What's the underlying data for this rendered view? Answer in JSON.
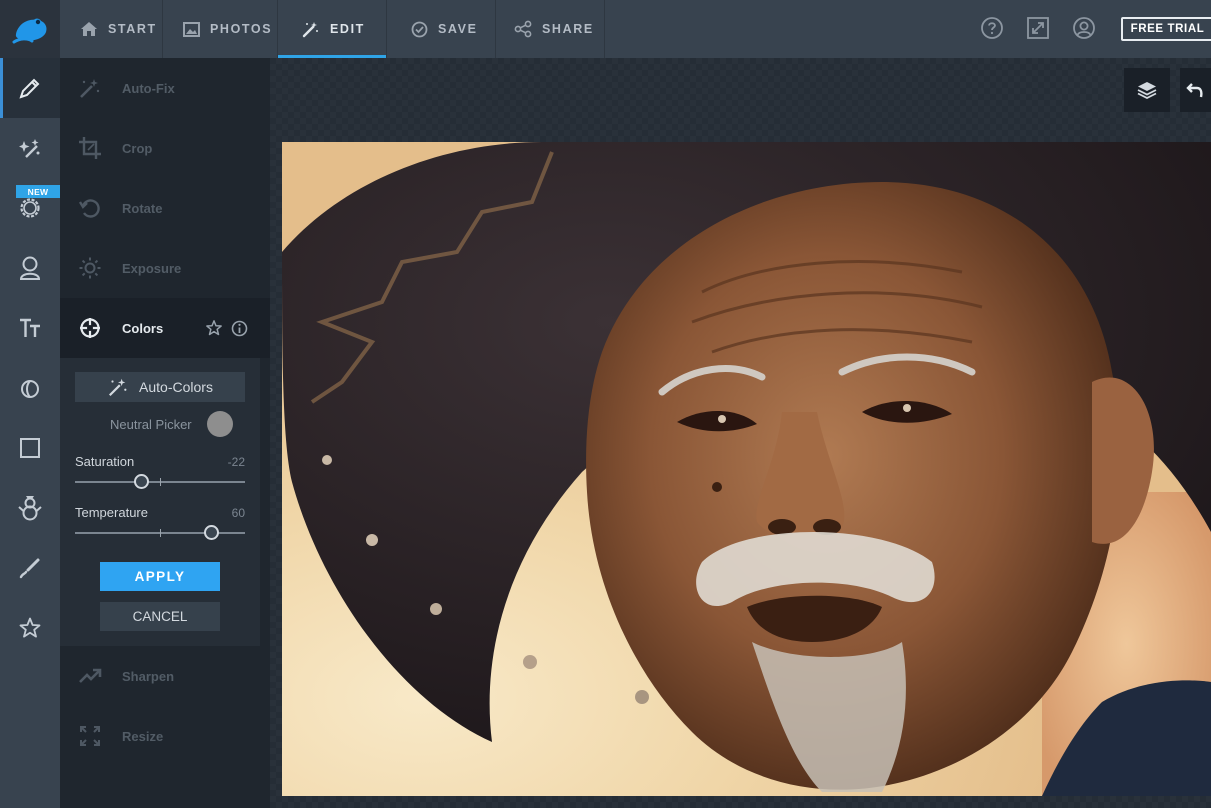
{
  "topbar": {
    "tabs": [
      {
        "label": "START",
        "icon": "home-icon"
      },
      {
        "label": "PHOTOS",
        "icon": "photos-icon"
      },
      {
        "label": "EDIT",
        "icon": "magic-wand-icon",
        "active": true
      },
      {
        "label": "SAVE",
        "icon": "check-circle-icon"
      },
      {
        "label": "SHARE",
        "icon": "share-icon"
      }
    ],
    "right_icons": [
      "help-icon",
      "fullscreen-icon",
      "account-icon"
    ],
    "free_trial_label": "FREE TRIAL"
  },
  "rail": {
    "new_badge": "NEW",
    "items": [
      "pencil-icon",
      "effects-icon",
      "gear-icon",
      "portrait-icon",
      "text-icon",
      "overlay-icon",
      "frame-icon",
      "sticker-icon",
      "brush-icon",
      "star-icon"
    ]
  },
  "panel": {
    "items": [
      {
        "label": "Auto-Fix",
        "icon": "magic-wand-icon"
      },
      {
        "label": "Crop",
        "icon": "crop-icon"
      },
      {
        "label": "Rotate",
        "icon": "rotate-icon"
      },
      {
        "label": "Exposure",
        "icon": "sun-icon"
      },
      {
        "label": "Colors",
        "icon": "colors-icon",
        "open": true
      },
      {
        "label": "Sharpen",
        "icon": "sharpen-icon"
      },
      {
        "label": "Resize",
        "icon": "resize-icon"
      }
    ],
    "colors": {
      "auto_colors_label": "Auto-Colors",
      "neutral_picker_label": "Neutral Picker",
      "sliders": [
        {
          "label": "Saturation",
          "value": "-22",
          "fraction": 0.39
        },
        {
          "label": "Temperature",
          "value": "60",
          "fraction": 0.8
        }
      ],
      "apply_label": "APPLY",
      "cancel_label": "CANCEL"
    }
  },
  "canvas": {
    "buttons": [
      "layers-icon",
      "undo-icon"
    ]
  },
  "colors": {
    "accent": "#2fa4e7",
    "topbar": "#38434f",
    "panel": "#1f262e"
  }
}
